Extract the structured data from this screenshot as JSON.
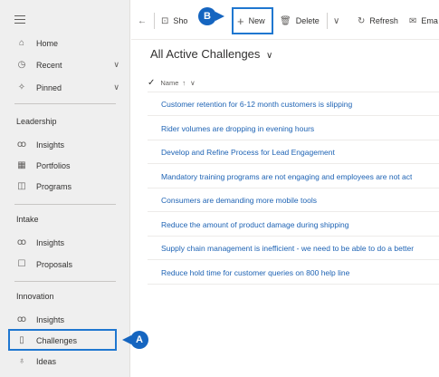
{
  "sidebar": {
    "top_items": [
      {
        "label": "Home",
        "icon": "home-icon"
      },
      {
        "label": "Recent",
        "icon": "clock-icon"
      },
      {
        "label": "Pinned",
        "icon": "pin-icon"
      }
    ],
    "sections": [
      {
        "title": "Leadership",
        "items": [
          "Insights",
          "Portfolios",
          "Programs"
        ]
      },
      {
        "title": "Intake",
        "items": [
          "Insights",
          "Proposals"
        ]
      },
      {
        "title": "Innovation",
        "items": [
          "Insights",
          "Challenges",
          "Ideas"
        ]
      }
    ]
  },
  "toolbar": {
    "show_chart": "Sho",
    "new": "New",
    "delete": "Delete",
    "refresh": "Refresh",
    "email": "Ema"
  },
  "view": {
    "title": "All Active Challenges",
    "column_name": "Name"
  },
  "rows": [
    "Customer retention for 6-12 month customers is slipping",
    "Rider volumes are dropping in evening hours",
    "Develop and Refine Process for Lead Engagement",
    "Mandatory training programs are not engaging and employees are not act",
    "Consumers are demanding more mobile tools",
    "Reduce the amount of product damage during shipping",
    "Supply chain management is inefficient - we need to be able to do a better",
    "Reduce hold time for customer queries on 800 help line"
  ],
  "callouts": {
    "a": "A",
    "b": "B"
  },
  "colors": {
    "accent": "#1f77d0",
    "link": "#1e63b4",
    "badge": "#1565c0"
  }
}
